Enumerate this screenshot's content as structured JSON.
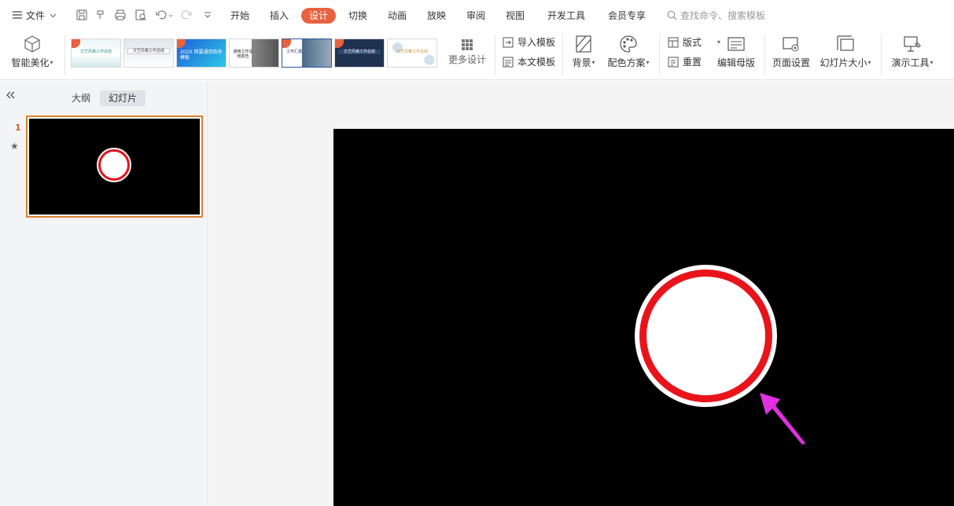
{
  "menubar": {
    "file_label": "文件",
    "tabs": [
      {
        "label": "开始"
      },
      {
        "label": "插入"
      },
      {
        "label": "设计"
      },
      {
        "label": "切换"
      },
      {
        "label": "动画"
      },
      {
        "label": "放映"
      },
      {
        "label": "审阅"
      },
      {
        "label": "视图"
      },
      {
        "label": "开发工具"
      },
      {
        "label": "会员专享"
      }
    ],
    "active_tab": "设计",
    "search_placeholder": "查找命令、搜索模板",
    "accent_color": "#e8623f"
  },
  "ribbon": {
    "smart_beautify": "智能美化",
    "templates": [
      {
        "text": "文艺风格工作总结"
      },
      {
        "text": "文艺风格工作总结"
      },
      {
        "text": "202X 简要通用商务模板"
      },
      {
        "text": "通用工作总结报告"
      },
      {
        "text": "工作汇报"
      },
      {
        "text": "文艺风格工作总结"
      },
      {
        "text": "文艺风格工作总结"
      }
    ],
    "more_design": "更多设计",
    "import_template": "导入模板",
    "this_template": "本文模板",
    "background": "背景",
    "color_scheme": "配色方案",
    "layout": "版式",
    "reset": "重置",
    "edit_master": "编辑母版",
    "page_setup": "页面设置",
    "slide_size": "幻灯片大小",
    "presentation_tools": "演示工具"
  },
  "left_panel": {
    "tab_outline": "大纲",
    "tab_slides": "幻灯片",
    "slide_number": "1"
  },
  "colors": {
    "slide_background": "#000000",
    "circle_ring": "#e9141b",
    "arrow": "#e030e0",
    "thumb_selection": "#d9802e"
  }
}
